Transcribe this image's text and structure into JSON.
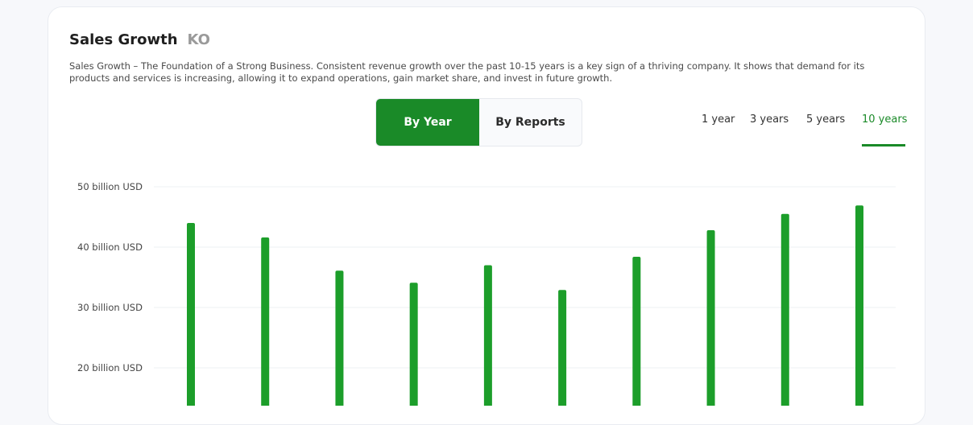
{
  "card": {
    "title": "Sales Growth",
    "ticker": "KO",
    "description": "Sales Growth – The Foundation of a Strong Business. Consistent revenue growth over the past 10-15 years is a key sign of a thriving company. It shows that demand for its products and services is increasing, allowing it to expand operations, gain market share, and invest in future growth."
  },
  "toggle": {
    "by_year": "By Year",
    "by_reports": "By Reports",
    "selected": "By Year"
  },
  "periods": {
    "items": [
      "1 year",
      "3 years",
      "5 years",
      "10 years"
    ],
    "selected": "10 years"
  },
  "colors": {
    "accent": "#1a8a28",
    "bar": "#1c9e2a"
  },
  "chart_data": {
    "type": "bar",
    "y_tick_labels": [
      "50 billion USD",
      "40 billion USD",
      "30 billion USD",
      "20 billion USD"
    ],
    "y_ticks": [
      50,
      40,
      30,
      20
    ],
    "values": [
      44.0,
      41.6,
      36.1,
      34.1,
      37.0,
      32.9,
      38.4,
      42.8,
      45.5,
      46.9
    ],
    "grid": true
  }
}
